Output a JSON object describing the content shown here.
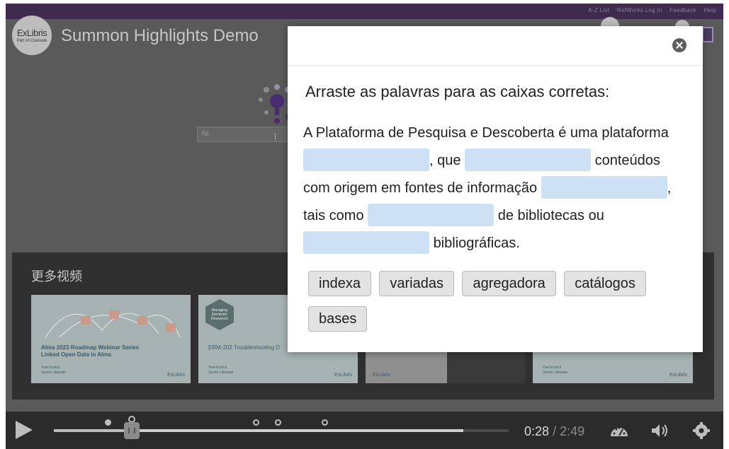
{
  "page_header_links": [
    "A-Z List",
    "RefWorks Log In",
    "Feedback",
    "Help"
  ],
  "logo": {
    "line1": "ExLibris",
    "line2": "Part of Clarivate"
  },
  "video_title": "Summon Highlights Demo",
  "search_placeholder": "Ni",
  "more_videos": {
    "label": "更多视频",
    "thumbnails": [
      {
        "title": "Alma 2023 Roadmap Webinar Series Linked Open Data in Alma",
        "presenter": "Yoel Kortick",
        "role": "Senior Librarian",
        "brand": "ExLibris"
      },
      {
        "badge": "Managing Electronic Resources",
        "title": "ERM-202 Troubleshooting D",
        "presenter": "Yoel Kortick",
        "role": "Senior Librarian",
        "brand": "ExLibris"
      },
      {
        "brand": "ExLibris"
      },
      {
        "presenter": "Yoel Kortick",
        "role": "Senior Librarian",
        "brand": "ExLibris"
      }
    ]
  },
  "dialog": {
    "title": "Arraste as palavras para as caixas corretas:",
    "text_segments": {
      "s1": "A Plataforma de Pesquisa e Descoberta é uma plataforma",
      "s2": ", que",
      "s3": "conteúdos com origem em fontes de informação",
      "s4": ", tais como",
      "s5": "de bibliotecas ou",
      "s6": "bibliográficas."
    },
    "choices": [
      "indexa",
      "variadas",
      "agregadora",
      "catálogos",
      "bases"
    ]
  },
  "player": {
    "current_time": "0:28",
    "separator": "/",
    "duration": "2:49",
    "progress_fraction": 0.166
  },
  "colors": {
    "drop_zone": "#cde0f4",
    "chip_bg": "#e3e3e3",
    "header_purple": "#3e2b4e"
  }
}
